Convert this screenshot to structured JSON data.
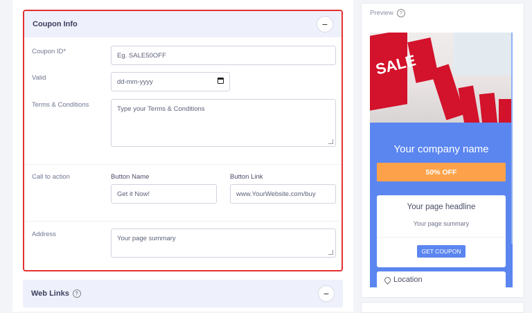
{
  "coupon_info": {
    "title": "Coupon Info",
    "collapse_symbol": "−",
    "coupon_id_label": "Coupon ID*",
    "coupon_id_placeholder": "Eg. SALE50OFF",
    "valid_label": "Valid",
    "valid_placeholder": "dd-mm-yyyy",
    "terms_label": "Terms & Conditions",
    "terms_placeholder": "Type your Terms & Conditions",
    "cta_label": "Call to action",
    "button_name_label": "Button Name",
    "button_name_value": "Get it Now!",
    "button_link_label": "Button Link",
    "button_link_value": "www.YourWebsite.com/buy",
    "address_label": "Address",
    "address_placeholder": "Your page summary"
  },
  "web_links": {
    "title": "Web Links",
    "help_symbol": "?",
    "collapse_symbol": "−"
  },
  "preview": {
    "label": "Preview",
    "help_symbol": "?",
    "sale_sign": "SALE",
    "company_name": "Your company name",
    "offer": "50% OFF",
    "headline": "Your page headline",
    "summary": "Your page summary",
    "button": "GET COUPON",
    "location": "Location"
  },
  "colors": {
    "accent": "#5b86f0",
    "offer": "#fda24a",
    "highlight_border": "#e53030"
  }
}
